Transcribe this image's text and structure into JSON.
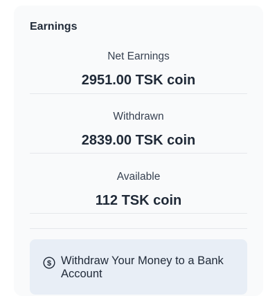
{
  "card": {
    "title": "Earnings"
  },
  "stats": [
    {
      "label": "Net Earnings",
      "value": "2951.00 TSK coin"
    },
    {
      "label": "Withdrawn",
      "value": "2839.00 TSK coin"
    },
    {
      "label": "Available",
      "value": "112 TSK coin"
    }
  ],
  "withdraw": {
    "label": "Withdraw Your Money to a Bank Account",
    "icon": "dollar-circle-icon"
  }
}
